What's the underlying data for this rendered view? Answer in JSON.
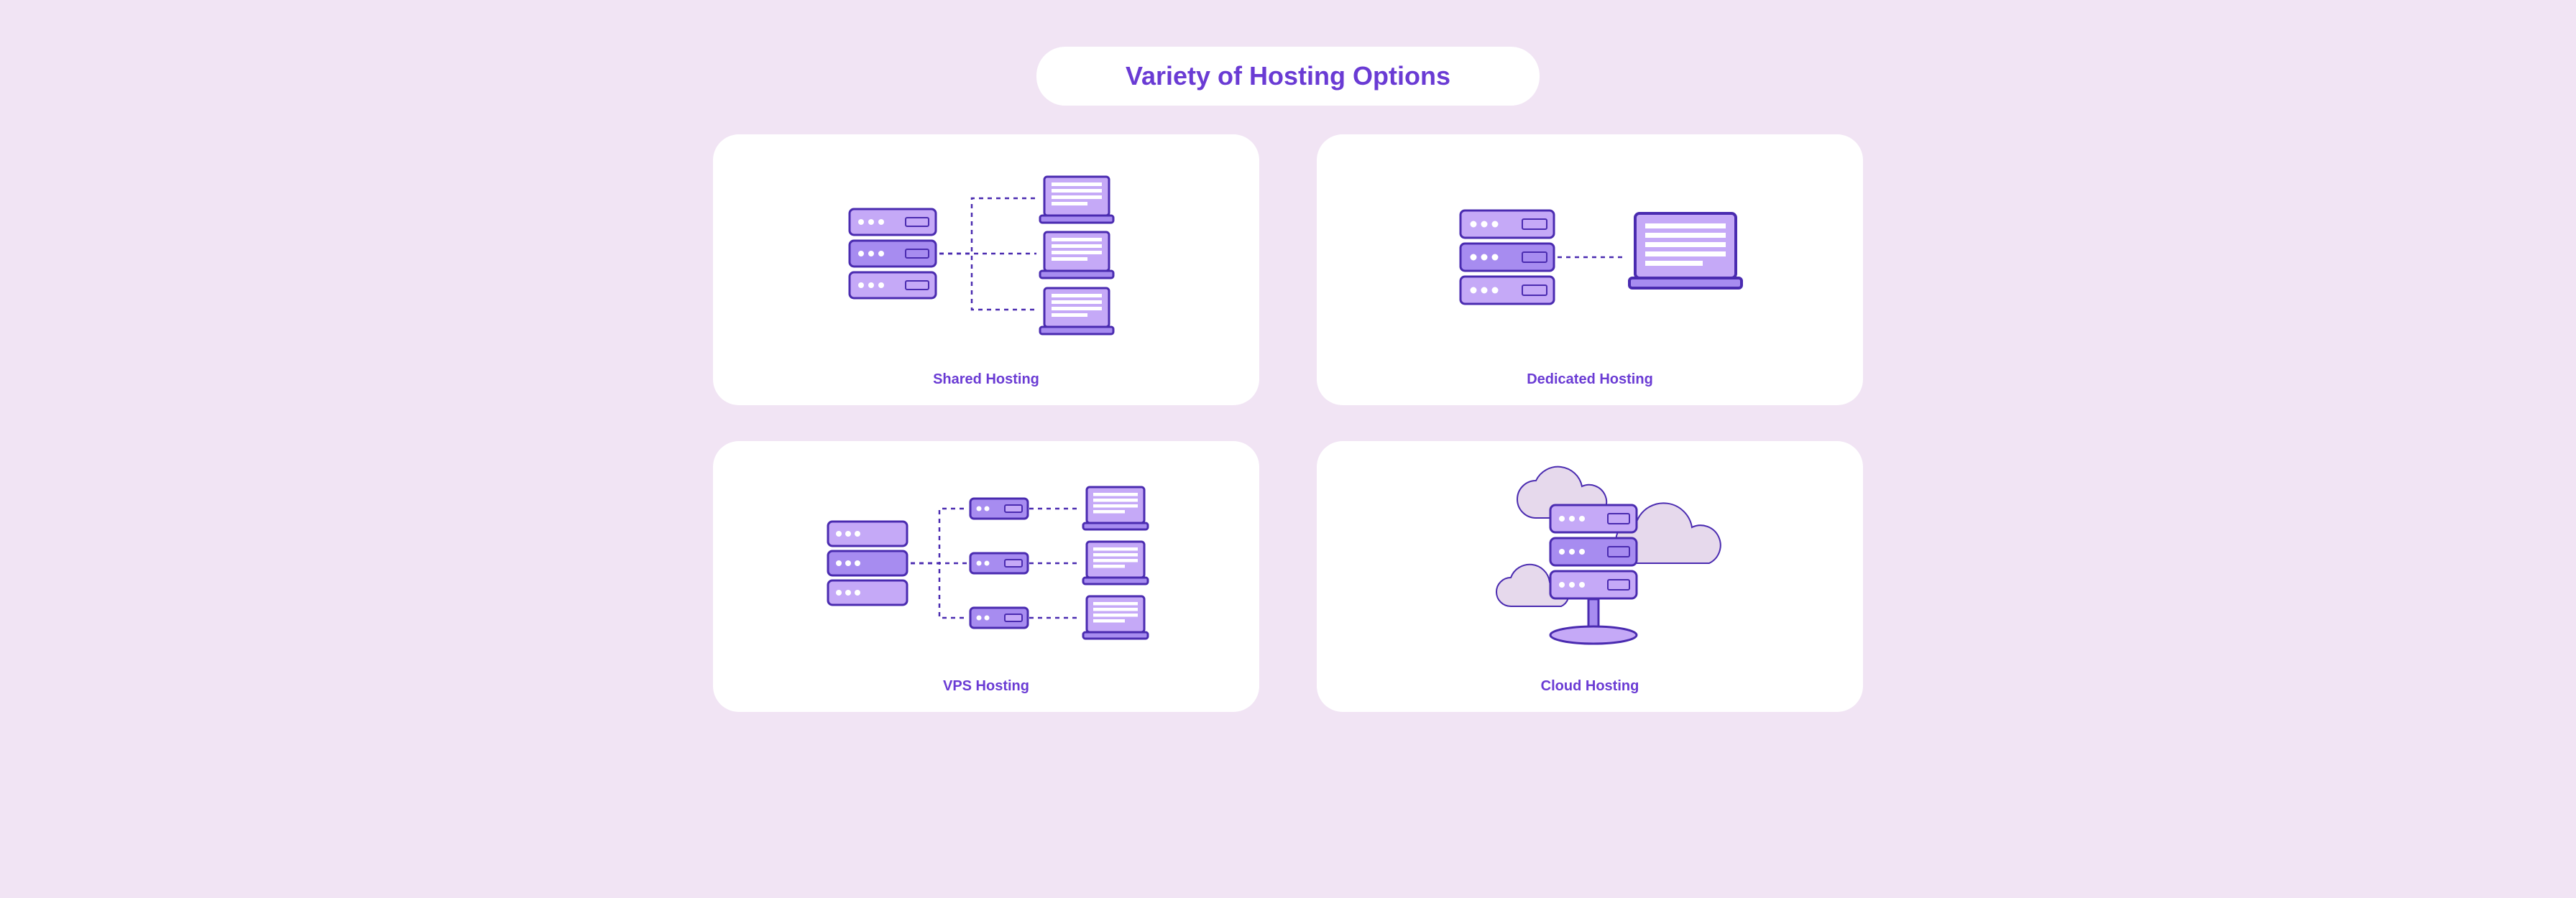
{
  "title": "Variety of Hosting Options",
  "cards": {
    "shared": {
      "label": "Shared Hosting"
    },
    "dedicated": {
      "label": "Dedicated Hosting"
    },
    "vps": {
      "label": "VPS Hosting"
    },
    "cloud": {
      "label": "Cloud Hosting"
    }
  },
  "palette": {
    "accent": "#6a3bd4",
    "fillLight": "#c5a9f7",
    "fillMed": "#a78cf0",
    "stroke": "#4a2bb0",
    "cloud": "#e6d9ec",
    "bg": "#f1e4f4"
  }
}
